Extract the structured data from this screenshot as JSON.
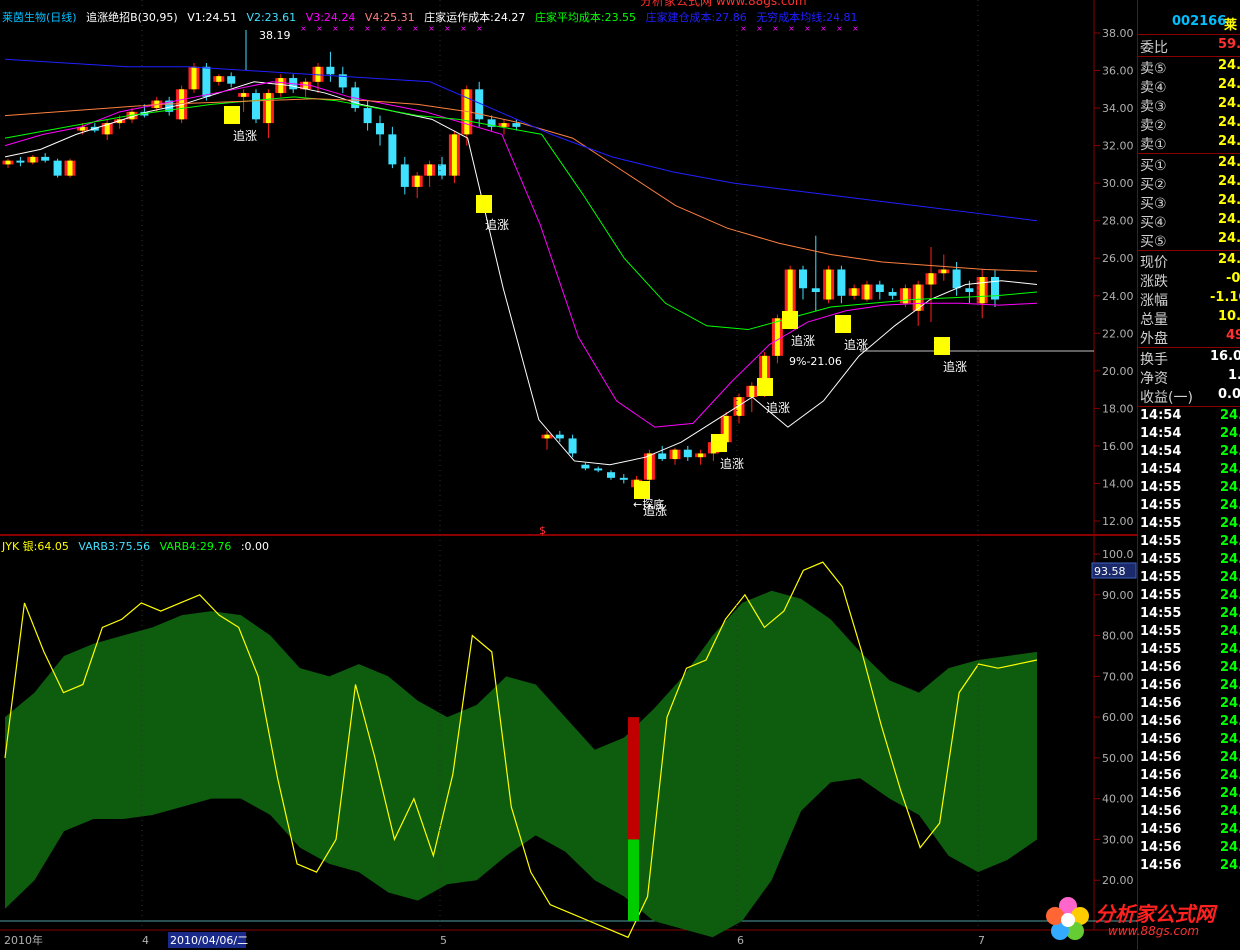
{
  "header": {
    "stock_name": "莱茵生物(日线)",
    "indicator": "追涨绝招B(30,95)",
    "v1": "V1:24.51",
    "v2": "V2:23.61",
    "v3": "V3:24.24",
    "v4": "V4:25.31",
    "zj_op": "庄家运作成本:24.27",
    "zj_avg": "庄家平均成本:23.55",
    "zj_hold": "庄家建仓成本:27.86",
    "free": "无穷成本均线:24.81"
  },
  "colors": {
    "up": "#ff2020",
    "down": "#40e0ff",
    "yellow": "#ffff00",
    "band": "#0e5c0e",
    "axis": "#8a0000"
  },
  "lower_header": {
    "a": "JYK 银:64.05",
    "b": "VARB3:75.56",
    "c": "VARB4:29.76",
    "d": ":0.00"
  },
  "labels": {
    "zhuizhang": "追涨",
    "peak": "38.19",
    "low_note": "←探底",
    "mid_note": "9%-21.06",
    "dollar": "$",
    "value_box": "93.58"
  },
  "xaxis": {
    "year": "2010年",
    "m4": "4",
    "date": "2010/04/06/二",
    "m5": "5",
    "m6": "6",
    "m7": "7"
  },
  "chart_data": [
    {
      "type": "candlestick",
      "ylim": [
        12,
        38
      ],
      "yticks": [
        "38.00",
        "36.00",
        "34.00",
        "32.00",
        "30.00",
        "28.00",
        "26.00",
        "24.00",
        "22.00",
        "20.00",
        "18.00",
        "16.00",
        "14.00",
        "12.00"
      ],
      "candles": [
        [
          31.0,
          31.3,
          30.8,
          31.2
        ],
        [
          31.2,
          31.4,
          30.9,
          31.1
        ],
        [
          31.1,
          31.5,
          31.0,
          31.4
        ],
        [
          31.4,
          31.6,
          31.1,
          31.2
        ],
        [
          31.2,
          31.3,
          30.3,
          30.4
        ],
        [
          30.4,
          31.3,
          30.3,
          31.2
        ],
        [
          32.8,
          33.2,
          32.6,
          33.0
        ],
        [
          33.0,
          33.2,
          32.7,
          32.8
        ],
        [
          32.6,
          33.4,
          32.3,
          33.2
        ],
        [
          33.2,
          33.6,
          32.9,
          33.4
        ],
        [
          33.4,
          34.0,
          33.2,
          33.8
        ],
        [
          33.8,
          34.2,
          33.5,
          33.6
        ],
        [
          34.0,
          34.6,
          33.8,
          34.4
        ],
        [
          34.4,
          34.6,
          33.6,
          33.8
        ],
        [
          33.4,
          35.2,
          33.2,
          35.0
        ],
        [
          35.0,
          36.4,
          34.8,
          36.2
        ],
        [
          36.2,
          36.4,
          34.4,
          34.6
        ],
        [
          35.4,
          35.8,
          35.2,
          35.7
        ],
        [
          35.7,
          35.9,
          35.1,
          35.3
        ],
        [
          34.6,
          35.0,
          33.8,
          34.8
        ],
        [
          34.8,
          35.0,
          33.2,
          33.4
        ],
        [
          33.2,
          35.0,
          32.4,
          34.8
        ],
        [
          34.8,
          35.8,
          34.6,
          35.6
        ],
        [
          35.6,
          35.8,
          34.8,
          35.0
        ],
        [
          35.0,
          35.6,
          34.6,
          35.4
        ],
        [
          35.4,
          36.4,
          34.8,
          36.2
        ],
        [
          36.2,
          37.0,
          35.4,
          35.8
        ],
        [
          35.8,
          36.2,
          34.8,
          35.1
        ],
        [
          35.1,
          35.4,
          33.8,
          34.0
        ],
        [
          34.0,
          34.4,
          32.8,
          33.2
        ],
        [
          33.2,
          33.6,
          32.0,
          32.6
        ],
        [
          32.6,
          33.0,
          30.8,
          31.0
        ],
        [
          31.0,
          31.4,
          29.4,
          29.8
        ],
        [
          29.8,
          30.6,
          29.2,
          30.4
        ],
        [
          30.4,
          31.2,
          29.8,
          31.0
        ],
        [
          31.0,
          31.4,
          30.2,
          30.4
        ],
        [
          30.4,
          32.8,
          30.0,
          32.6
        ],
        [
          32.6,
          35.2,
          32.0,
          35.0
        ],
        [
          35.0,
          35.4,
          33.0,
          33.4
        ],
        [
          33.4,
          33.6,
          32.8,
          33.0
        ],
        [
          33.0,
          33.4,
          32.6,
          33.2
        ],
        [
          33.2,
          33.4,
          32.8,
          33.0
        ],
        [
          16.4,
          16.8,
          15.8,
          16.6
        ],
        [
          16.6,
          16.8,
          16.2,
          16.4
        ],
        [
          16.4,
          16.6,
          15.4,
          15.6
        ],
        [
          15.0,
          15.1,
          14.7,
          14.8
        ],
        [
          14.8,
          14.9,
          14.6,
          14.7
        ],
        [
          14.6,
          14.7,
          14.2,
          14.3
        ],
        [
          14.3,
          14.5,
          14.0,
          14.2
        ],
        [
          13.8,
          14.4,
          13.4,
          14.2
        ],
        [
          14.2,
          15.8,
          14.0,
          15.6
        ],
        [
          15.6,
          16.0,
          15.2,
          15.3
        ],
        [
          15.3,
          15.9,
          15.0,
          15.8
        ],
        [
          15.8,
          16.0,
          15.2,
          15.4
        ],
        [
          15.4,
          15.8,
          15.0,
          15.6
        ],
        [
          15.6,
          16.4,
          15.2,
          16.2
        ],
        [
          16.2,
          17.8,
          16.0,
          17.6
        ],
        [
          17.6,
          18.8,
          17.2,
          18.6
        ],
        [
          18.6,
          19.4,
          17.8,
          19.2
        ],
        [
          19.2,
          21.0,
          18.6,
          20.8
        ],
        [
          20.8,
          23.0,
          20.4,
          22.8
        ],
        [
          22.8,
          25.6,
          22.4,
          25.4
        ],
        [
          25.4,
          25.6,
          23.8,
          24.4
        ],
        [
          24.4,
          27.2,
          23.2,
          24.2
        ],
        [
          23.8,
          25.6,
          23.6,
          25.4
        ],
        [
          25.4,
          25.6,
          23.6,
          24.0
        ],
        [
          24.0,
          24.6,
          23.8,
          24.4
        ],
        [
          23.8,
          24.8,
          23.7,
          24.6
        ],
        [
          24.6,
          24.8,
          23.8,
          24.2
        ],
        [
          24.2,
          24.4,
          23.8,
          24.0
        ],
        [
          23.6,
          24.6,
          23.4,
          24.4
        ],
        [
          23.2,
          24.8,
          22.4,
          24.6
        ],
        [
          24.6,
          26.6,
          22.6,
          25.2
        ],
        [
          25.2,
          26.2,
          24.8,
          25.4
        ],
        [
          25.4,
          25.8,
          24.0,
          24.4
        ],
        [
          24.4,
          24.8,
          23.6,
          24.2
        ],
        [
          23.6,
          25.4,
          22.8,
          25.0
        ],
        [
          25.0,
          25.4,
          23.4,
          23.8
        ]
      ],
      "series": [
        {
          "name": "V1",
          "color": "#ffffff",
          "points": [
            31.4,
            31.8,
            32.6,
            33.2,
            33.8,
            34.2,
            34.8,
            35.4,
            35.2,
            34.8,
            34.2,
            33.8,
            33.4,
            32.4,
            24.4,
            17.4,
            15.2,
            15.0,
            15.4,
            16.2,
            17.4,
            18.6,
            17.0,
            18.4,
            20.8,
            22.4,
            23.8,
            24.6,
            24.8,
            24.6
          ]
        },
        {
          "name": "V2",
          "color": "#ff00ff",
          "points": [
            32.0,
            32.6,
            33.0,
            33.8,
            34.2,
            34.6,
            35.0,
            35.4,
            35.2,
            34.6,
            34.2,
            33.8,
            33.2,
            32.6,
            27.8,
            21.8,
            18.4,
            17.0,
            17.2,
            19.4,
            21.4,
            22.6,
            23.2,
            23.5,
            23.6,
            23.6,
            23.5,
            23.6
          ]
        },
        {
          "name": "V3",
          "color": "#00ff00",
          "points": [
            32.4,
            32.8,
            33.2,
            33.6,
            33.9,
            34.2,
            34.4,
            34.6,
            34.4,
            34.0,
            33.6,
            33.4,
            33.0,
            32.6,
            29.4,
            26.0,
            23.6,
            22.4,
            22.2,
            22.8,
            23.4,
            23.6,
            23.8,
            23.9,
            24.0,
            24.2
          ]
        },
        {
          "name": "V4",
          "color": "#ff8040",
          "points": [
            33.6,
            33.8,
            34.0,
            34.2,
            34.3,
            34.4,
            34.5,
            34.4,
            34.2,
            33.8,
            33.2,
            32.4,
            30.6,
            28.8,
            27.6,
            26.8,
            26.2,
            25.8,
            25.6,
            25.4,
            25.3
          ]
        },
        {
          "name": "V5",
          "color": "#2020ff",
          "points": [
            36.6,
            36.4,
            36.2,
            36.2,
            36.0,
            35.8,
            35.6,
            35.4,
            34.0,
            32.6,
            31.4,
            30.6,
            30.0,
            29.6,
            29.2,
            28.8,
            28.4,
            28.0
          ]
        }
      ]
    },
    {
      "type": "area",
      "ylim": [
        10,
        100
      ],
      "yticks": [
        "100.0",
        "90.00",
        "80.00",
        "70.00",
        "60.00",
        "50.00",
        "40.00",
        "30.00",
        "20.00"
      ],
      "band_upper": [
        60,
        66,
        75,
        78,
        80,
        82,
        85,
        86,
        85,
        80,
        72,
        70,
        73,
        70,
        64,
        60,
        63,
        70,
        68,
        60,
        52,
        55,
        62,
        70,
        80,
        88,
        91,
        89,
        84,
        76,
        69,
        66,
        72,
        74,
        75,
        76
      ],
      "band_lower": [
        13,
        20,
        32,
        35,
        35,
        36,
        38,
        40,
        40,
        36,
        28,
        24,
        22,
        17,
        15,
        19,
        20,
        26,
        31,
        27,
        20,
        16,
        10,
        8,
        6,
        10,
        20,
        37,
        44,
        45,
        40,
        36,
        26,
        22,
        25,
        30
      ],
      "line": [
        50,
        88,
        76,
        66,
        68,
        82,
        84,
        88,
        86,
        88,
        90,
        85,
        82,
        70,
        45,
        24,
        22,
        30,
        68,
        50,
        30,
        40,
        26,
        46,
        80,
        76,
        38,
        22,
        14,
        12,
        10,
        8,
        6,
        16,
        60,
        72,
        74,
        84,
        90,
        82,
        86,
        96,
        98,
        92,
        76,
        58,
        42,
        28,
        34,
        66,
        73,
        72,
        73,
        74
      ],
      "bar_value": 60
    }
  ]
}
